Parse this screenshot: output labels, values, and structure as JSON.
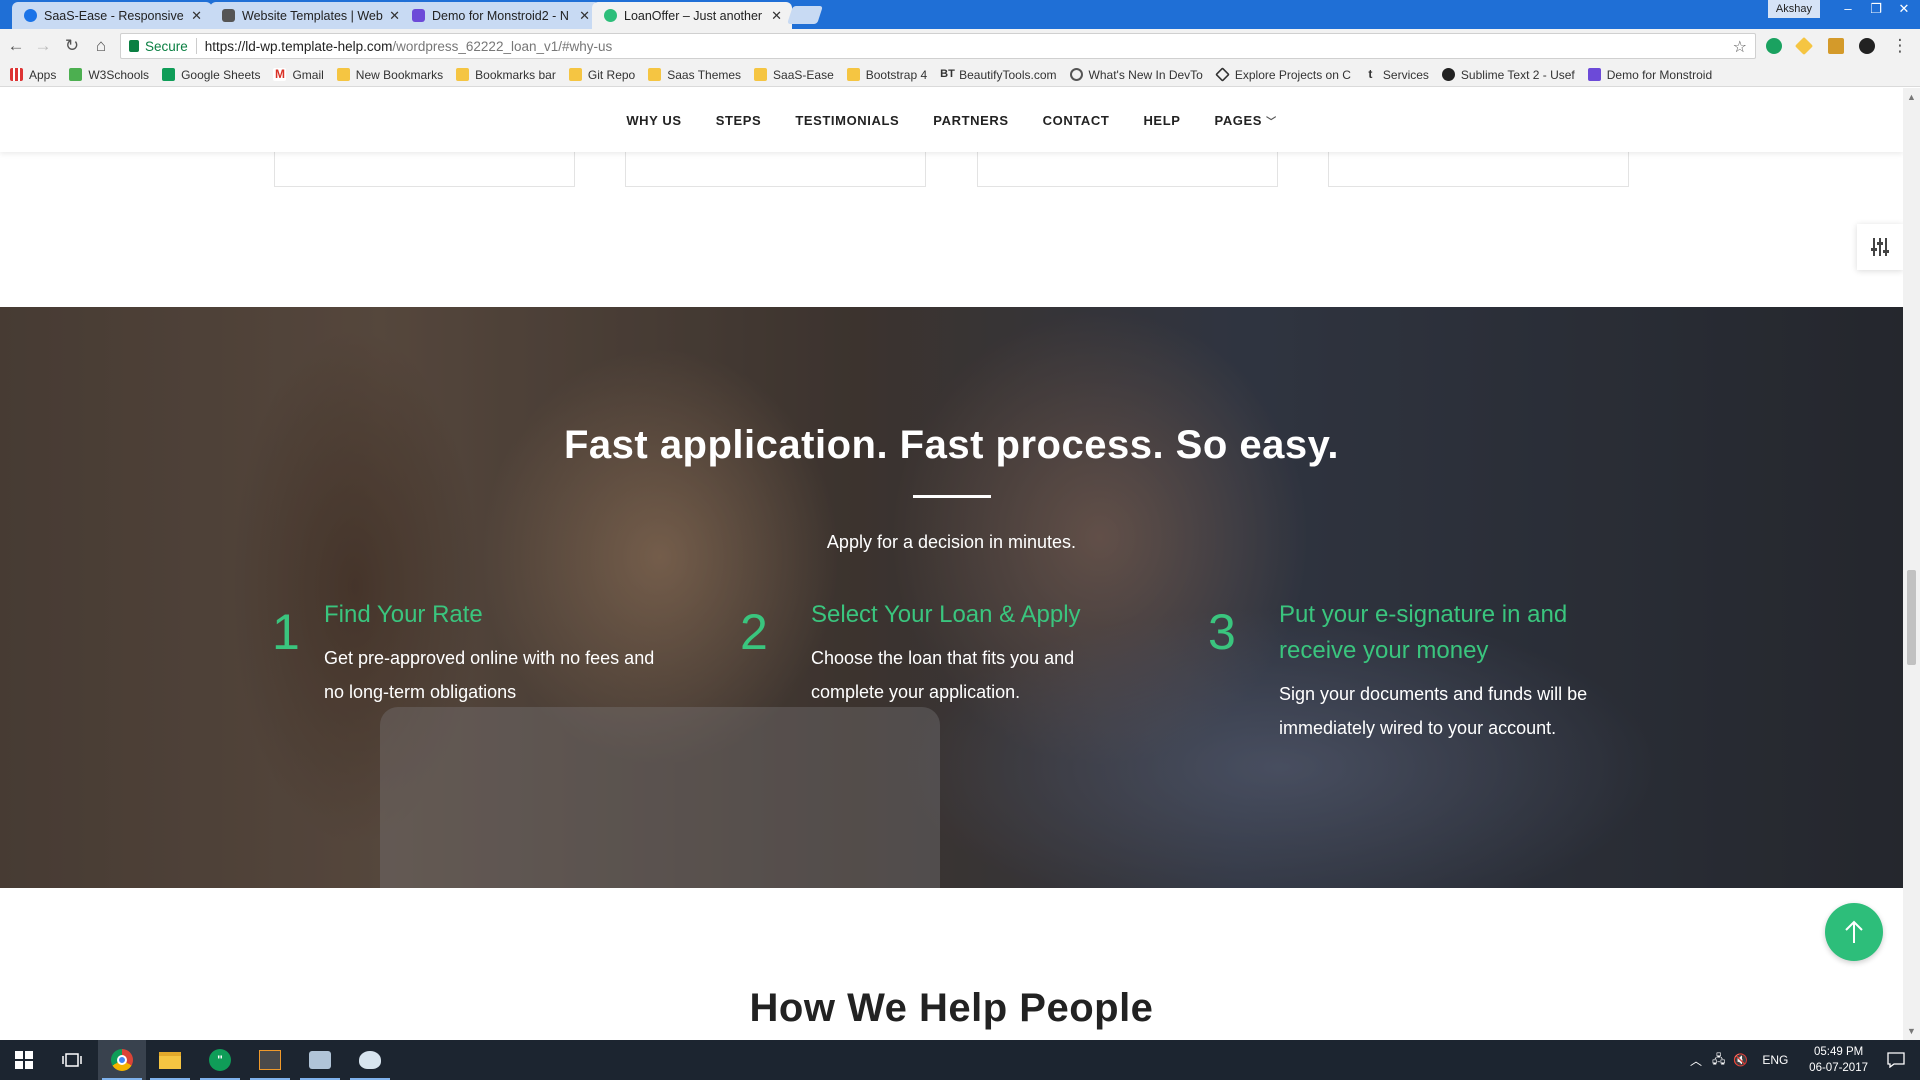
{
  "browser": {
    "tabs": [
      {
        "title": "SaaS-Ease - Responsive S",
        "color": "#1a73e8",
        "active": false
      },
      {
        "title": "Website Templates | Web",
        "color": "#555555",
        "active": false
      },
      {
        "title": "Demo for Monstroid2 - N",
        "color": "#6c4ad8",
        "active": false
      },
      {
        "title": "LoanOffer – Just another",
        "color": "#2dbe7a",
        "active": true
      }
    ],
    "window_user": "Akshay",
    "address": {
      "secure_label": "Secure",
      "url_host": "https://ld-wp.template-help.com",
      "url_path": "/wordpress_62222_loan_v1/#why-us"
    },
    "bookmarks": [
      {
        "label": "Apps",
        "icon": "apps-icon"
      },
      {
        "label": "W3Schools",
        "icon": "w3schools-icon"
      },
      {
        "label": "Google Sheets",
        "icon": "sheets-icon"
      },
      {
        "label": "Gmail",
        "icon": "gmail-icon"
      },
      {
        "label": "New Bookmarks",
        "icon": "folder-icon"
      },
      {
        "label": "Bookmarks bar",
        "icon": "folder-icon"
      },
      {
        "label": "Git Repo",
        "icon": "folder-icon"
      },
      {
        "label": "Saas Themes",
        "icon": "folder-icon"
      },
      {
        "label": "SaaS-Ease",
        "icon": "folder-icon"
      },
      {
        "label": "Bootstrap 4",
        "icon": "folder-icon"
      },
      {
        "label": "BeautifyTools.com",
        "icon": "bt-icon"
      },
      {
        "label": "What's New In DevTo",
        "icon": "devtools-icon"
      },
      {
        "label": "Explore Projects on C",
        "icon": "codepen-icon"
      },
      {
        "label": "Services",
        "icon": "tumblr-icon"
      },
      {
        "label": "Sublime Text 2 - Usef",
        "icon": "github-icon"
      },
      {
        "label": "Demo for Monstroid",
        "icon": "monstroid-icon"
      }
    ]
  },
  "site": {
    "nav": [
      "WHY US",
      "STEPS",
      "TESTIMONIALS",
      "PARTNERS",
      "CONTACT",
      "HELP",
      "PAGES"
    ],
    "hero": {
      "title": "Fast application. Fast process. So easy.",
      "subtitle": "Apply for a decision in minutes.",
      "steps": [
        {
          "num": "1",
          "title": "Find Your Rate",
          "text": "Get pre-approved online with no fees and no long-term obligations"
        },
        {
          "num": "2",
          "title": "Select Your Loan & Apply",
          "text": "Choose the loan that fits you and complete your application."
        },
        {
          "num": "3",
          "title": "Put your e-signature in and receive your money",
          "text": "Sign your documents and funds will be immediately wired to your account."
        }
      ]
    },
    "next_section_title": "How We Help People",
    "accent_color": "#2dbe7a"
  },
  "taskbar": {
    "language": "ENG",
    "time": "05:49 PM",
    "date": "06-07-2017"
  }
}
